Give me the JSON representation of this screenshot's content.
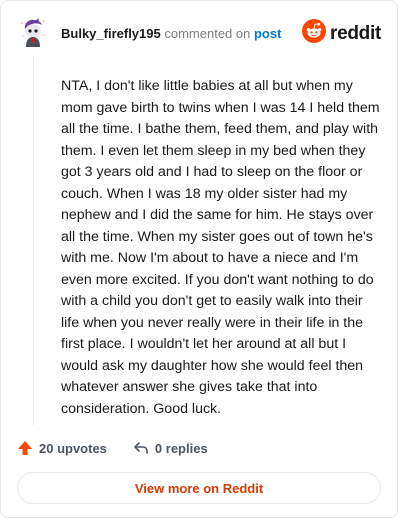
{
  "header": {
    "username": "Bulky_firefly195",
    "commented_text": "commented on",
    "post_link": "post",
    "brand_name": "reddit"
  },
  "comment": {
    "body": "NTA, I don't like little babies at all but when my mom gave birth to twins when I was 14 I held them all the time. I bathe them, feed them, and play with them. I even let them sleep in my bed when they got 3 years old and I had to sleep on the floor or couch. When I was 18 my older sister had my nephew and I did the same for him. He stays over all the time. When my sister goes out of town he's with me. Now I'm about to have a niece and I'm even more excited. If you don't want nothing to do with a child you don't get to easily walk into their life when you never really were in their life in the first place. I wouldn't let her around at all but I would ask my daughter how she would feel then whatever answer she gives take that into consideration. Good luck."
  },
  "actions": {
    "upvotes": "20 upvotes",
    "replies": "0 replies"
  },
  "footer": {
    "view_more_label": "View more on Reddit"
  },
  "colors": {
    "accent": "#ff4500",
    "link": "#0079d3",
    "view_more": "#d93a00",
    "avatar_purple": "#6b3fa0"
  },
  "icons": {
    "avatar": "snoo-avatar-icon",
    "brand": "reddit-logo-icon",
    "upvote": "upvote-arrow-icon",
    "reply": "reply-arrow-icon"
  }
}
